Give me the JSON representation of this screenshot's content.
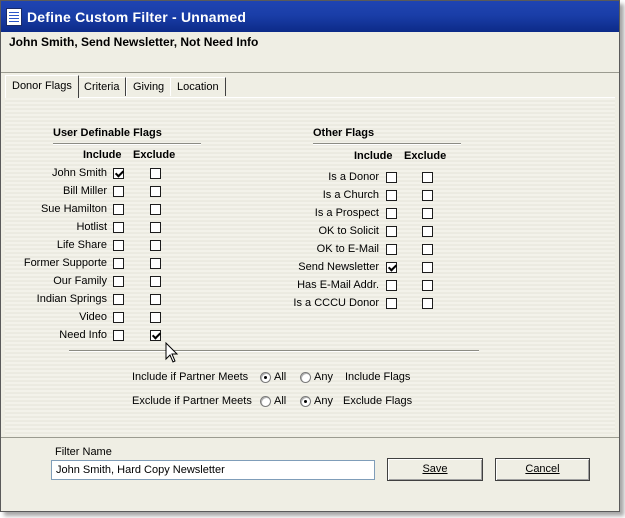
{
  "window": {
    "title": "Define Custom Filter - Unnamed"
  },
  "summary": "John Smith, Send Newsletter, Not Need Info",
  "tabs": [
    {
      "label": "Donor Flags",
      "active": true
    },
    {
      "label": "Criteria",
      "active": false
    },
    {
      "label": "Giving",
      "active": false
    },
    {
      "label": "Location",
      "active": false
    }
  ],
  "user_flags": {
    "heading": "User Definable Flags",
    "include_header": "Include",
    "exclude_header": "Exclude",
    "rows": [
      {
        "label": "John Smith",
        "include": true,
        "exclude": false
      },
      {
        "label": "Bill Miller",
        "include": false,
        "exclude": false
      },
      {
        "label": "Sue Hamilton",
        "include": false,
        "exclude": false
      },
      {
        "label": "Hotlist",
        "include": false,
        "exclude": false
      },
      {
        "label": "Life Share",
        "include": false,
        "exclude": false
      },
      {
        "label": "Former Supporte",
        "include": false,
        "exclude": false
      },
      {
        "label": "Our Family",
        "include": false,
        "exclude": false
      },
      {
        "label": "Indian Springs",
        "include": false,
        "exclude": false
      },
      {
        "label": "Video",
        "include": false,
        "exclude": false
      },
      {
        "label": "Need Info",
        "include": false,
        "exclude": true
      }
    ]
  },
  "other_flags": {
    "heading": "Other Flags",
    "include_header": "Include",
    "exclude_header": "Exclude",
    "rows": [
      {
        "label": "Is a Donor",
        "include": false,
        "exclude": false
      },
      {
        "label": "Is a Church",
        "include": false,
        "exclude": false
      },
      {
        "label": "Is a Prospect",
        "include": false,
        "exclude": false
      },
      {
        "label": "OK to Solicit",
        "include": false,
        "exclude": false
      },
      {
        "label": "OK to E-Mail",
        "include": false,
        "exclude": false
      },
      {
        "label": "Send Newsletter",
        "include": true,
        "exclude": false
      },
      {
        "label": "Has E-Mail Addr.",
        "include": false,
        "exclude": false
      },
      {
        "label": "Is a CCCU Donor",
        "include": false,
        "exclude": false
      }
    ]
  },
  "include_match": {
    "prefix": "Include if Partner Meets",
    "option_all": "All",
    "option_any": "Any",
    "suffix": "Include Flags",
    "selected": "All"
  },
  "exclude_match": {
    "prefix": "Exclude if Partner Meets",
    "option_all": "All",
    "option_any": "Any",
    "suffix": "Exclude Flags",
    "selected": "Any"
  },
  "footer": {
    "filter_name_label": "Filter Name",
    "filter_name_value": "John Smith, Hard Copy Newsletter",
    "save_label": "Save",
    "cancel_label": "Cancel"
  },
  "colors": {
    "titlebar": "#1a3ea8",
    "dialog_bg": "#efeee4"
  }
}
